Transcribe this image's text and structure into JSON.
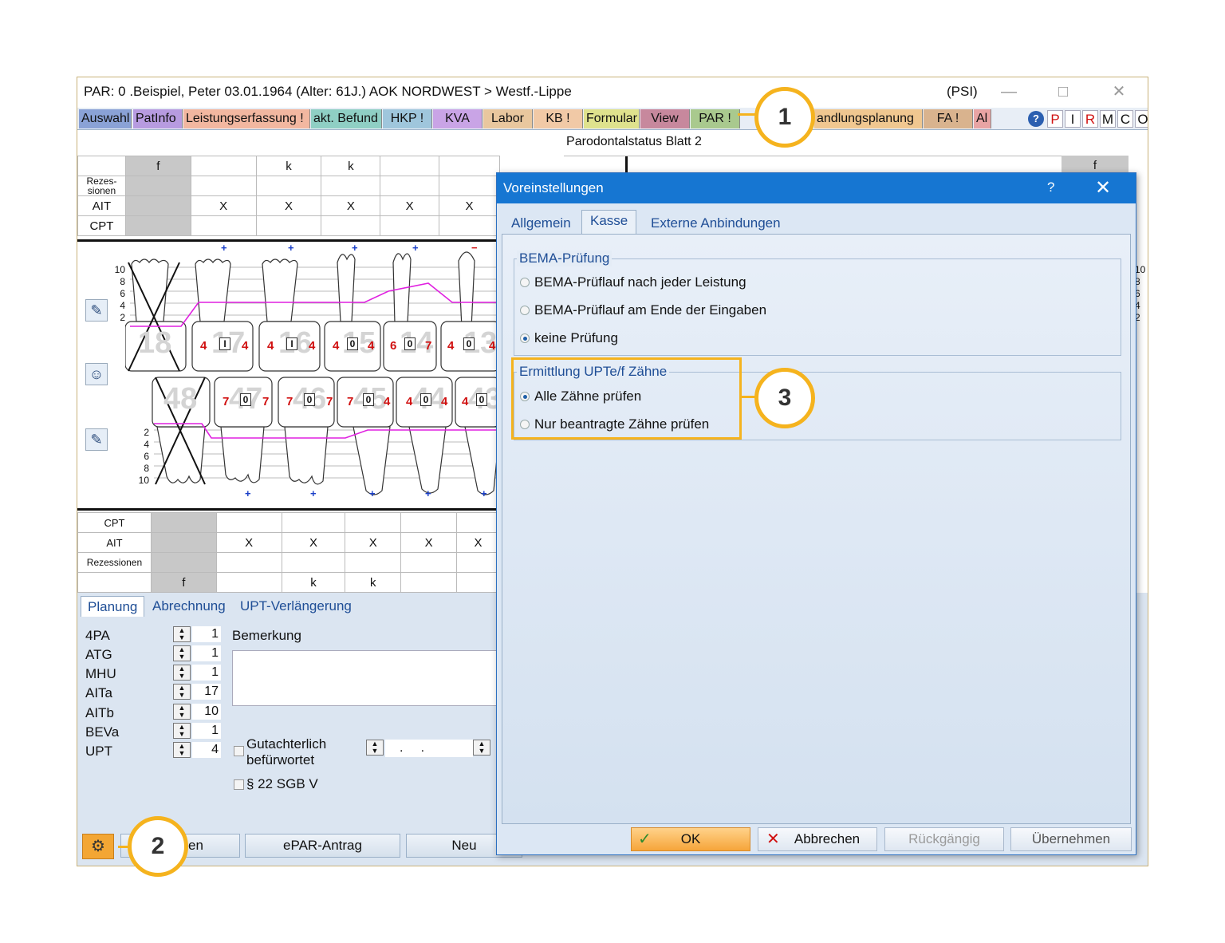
{
  "window": {
    "title": "PAR: 0  .Beispiel, Peter  03.01.1964 (Alter: 61J.)  AOK NORDWEST > Westf.-Lippe",
    "mode": "(PSI)",
    "controls": {
      "minimize": "—",
      "maximize": "□",
      "close": "✕"
    }
  },
  "toolbar": {
    "tabs": [
      {
        "label": "Auswahl",
        "color": "#8aa2d6"
      },
      {
        "label": "PatInfo",
        "color": "#b79be0"
      },
      {
        "label": "Leistungserfassung !",
        "color": "#f2b7a0"
      },
      {
        "label": "akt. Befund",
        "color": "#8fcfc4"
      },
      {
        "label": "HKP !",
        "color": "#9fc6dc"
      },
      {
        "label": "KVA",
        "color": "#c9a4e6"
      },
      {
        "label": "Labor",
        "color": "#e9c79e"
      },
      {
        "label": "KB !",
        "color": "#f1c9a6"
      },
      {
        "label": "Formular",
        "color": "#dfe28d"
      },
      {
        "label": "View",
        "color": "#c7889d"
      },
      {
        "label": "PAR !",
        "color": "#a9c98e"
      },
      {
        "label": "andlungsplanung",
        "color": "#f0c790"
      },
      {
        "label": "FA !",
        "color": "#d9b38e"
      },
      {
        "label": "Al",
        "color": "#e8a4a4"
      }
    ],
    "right_buttons": [
      "P",
      "I",
      "R",
      "M",
      "C",
      "O"
    ],
    "help_icon": "help-circle-icon"
  },
  "chart": {
    "sheet_title": "Parodontalstatus Blatt 2",
    "upper_rows": {
      "header": [
        "f",
        "",
        "k",
        "k",
        "",
        ""
      ],
      "header_right": "f",
      "rezessionen_label": "Rezes-\nsionen",
      "ait_label": "AIT",
      "ait_values": [
        "",
        "X",
        "X",
        "X",
        "X",
        "X"
      ],
      "cpt_label": "CPT"
    },
    "scale_top": [
      "10",
      "8",
      "6",
      "4",
      "2"
    ],
    "scale_bottom": [
      "2",
      "4",
      "6",
      "8",
      "10"
    ],
    "scale_right": [
      "10",
      "8",
      "6",
      "4",
      "2"
    ],
    "upper_teeth": [
      {
        "num": "18",
        "left": "",
        "center": "",
        "right": ""
      },
      {
        "num": "17",
        "left": "4",
        "center": "I",
        "right": "4"
      },
      {
        "num": "16",
        "left": "4",
        "center": "I",
        "right": "4"
      },
      {
        "num": "15",
        "left": "4",
        "center": "0",
        "right": "4"
      },
      {
        "num": "14",
        "left": "6",
        "center": "0",
        "right": "7"
      },
      {
        "num": "13",
        "left": "4",
        "center": "0",
        "right": "4"
      }
    ],
    "lower_teeth": [
      {
        "num": "48",
        "left": "",
        "center": "",
        "right": ""
      },
      {
        "num": "47",
        "left": "7",
        "center": "0",
        "right": "7"
      },
      {
        "num": "46",
        "left": "7",
        "center": "0",
        "right": "7"
      },
      {
        "num": "45",
        "left": "7",
        "center": "0",
        "right": "4"
      },
      {
        "num": "44",
        "left": "4",
        "center": "0",
        "right": "4"
      },
      {
        "num": "43",
        "left": "4",
        "center": "0",
        "right": ""
      }
    ],
    "upper_signs": [
      "+",
      "+",
      "+",
      "+",
      "−"
    ],
    "lower_signs": [
      "+",
      "+",
      "+",
      "+",
      "+"
    ],
    "lower_rows": {
      "cpt_label": "CPT",
      "ait_label": "AIT",
      "ait_values": [
        "",
        "X",
        "X",
        "X",
        "X",
        "X"
      ],
      "rezessionen_label": "Rezessionen",
      "footer": [
        "f",
        "",
        "k",
        "k",
        "",
        ""
      ]
    }
  },
  "bottom_panel": {
    "tabs": [
      "Planung",
      "Abrechnung",
      "UPT-Verlängerung"
    ],
    "params": [
      {
        "label": "4PA",
        "value": "1"
      },
      {
        "label": "ATG",
        "value": "1"
      },
      {
        "label": "MHU",
        "value": "1"
      },
      {
        "label": "AITa",
        "value": "17"
      },
      {
        "label": "AITb",
        "value": "10"
      },
      {
        "label": "BEVa",
        "value": "1"
      },
      {
        "label": "UPT",
        "value": "4"
      }
    ],
    "bemerkung_label": "Bemerkung",
    "gutachterlich_label": "Gutachterlich\nbefürwortet",
    "date_value": ".     .",
    "sgb_label": "§ 22 SGB V",
    "buttons": {
      "first": "en",
      "epar": "ePAR-Antrag",
      "neu": "Neu"
    }
  },
  "dialog": {
    "title": "Voreinstellungen",
    "help": "?",
    "close": "✕",
    "tabs": [
      "Allgemein",
      "Kasse",
      "Externe Anbindungen"
    ],
    "active_tab": "Kasse",
    "bema_group": {
      "label": "BEMA-Prüfung",
      "options": [
        {
          "label": "BEMA-Prüflauf nach jeder Leistung",
          "selected": false
        },
        {
          "label": "BEMA-Prüflauf am Ende der Eingaben",
          "selected": false
        },
        {
          "label": "keine Prüfung",
          "selected": true
        }
      ]
    },
    "upt_group": {
      "label": "Ermittlung UPTe/f Zähne",
      "options": [
        {
          "label": "Alle Zähne prüfen",
          "selected": true
        },
        {
          "label": "Nur beantragte Zähne prüfen",
          "selected": false
        }
      ]
    },
    "buttons": {
      "ok": "OK",
      "cancel": "Abbrechen",
      "undo": "Rückgängig",
      "apply": "Übernehmen"
    }
  },
  "callouts": [
    "1",
    "2",
    "3"
  ],
  "colors": {
    "callout": "#f5b31e",
    "dialog_title": "#1676d2",
    "ok_button": "#f6a53a",
    "tab_link": "#1f4e96",
    "probing_line": "#e020e0",
    "pocket_depth": "#d01010"
  }
}
